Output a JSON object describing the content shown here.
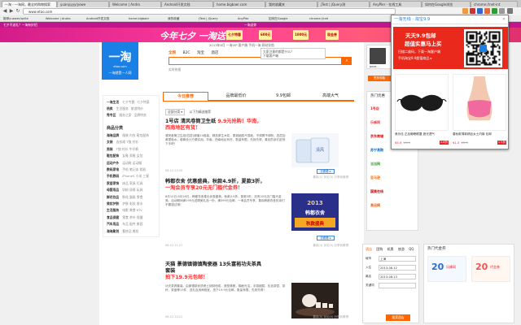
{
  "browser": {
    "tabs": [
      {
        "label": "一淘 - 一淘网，最全的购物搜索"
      },
      {
        "label": "yuanyyyy/yowe"
      },
      {
        "label": "Welcome | Andro"
      },
      {
        "label": "Android开发文档"
      },
      {
        "label": "home.bigbaer.com"
      },
      {
        "label": "我的收藏夹"
      },
      {
        "label": "jTest | jQuery测"
      },
      {
        "label": "AnyPler - 在线工具"
      },
      {
        "label": "如何在Google浏览"
      },
      {
        "label": "chrome://net-int"
      }
    ],
    "url": "www.etao.com",
    "back_glyph": "◀",
    "forward_glyph": "▶",
    "reload_glyph": "↻",
    "bookmarks": [
      "推荐yuewer/qnlte",
      "Welcome | Andro",
      "Android开发文档",
      "home.bigbaer",
      "我的收藏",
      "jTest | jQuery",
      "AnyPler",
      "如何在Google",
      "chrome://net",
      "其他书签"
    ]
  },
  "top_strip": {
    "left": "七夕不送礼？一淘有妙招",
    "center": "一淘送你",
    "right": "登录  注册  我的一淘"
  },
  "banner": {
    "headline": "今年七夕 一淘送你",
    "chips": [
      "七夕特惠",
      "600元",
      "1000元",
      "现金券"
    ]
  },
  "logo": {
    "name": "一淘",
    "domain": "etao.com",
    "slogan": "一淘就是一人网"
  },
  "search": {
    "tabs": [
      "全网",
      "B2C",
      "淘宝",
      "酒店"
    ],
    "active_tab": "全网",
    "placeholder": "",
    "button_glyph": "⌕",
    "hot": "实时热搜"
  },
  "top_links": "2013年8月  一淘VIP  客户端  手机一淘  网站导航",
  "suggest": [
    "大家注意的都是什么？",
    "下载客户端"
  ],
  "categories": {
    "rows": [
      {
        "main": "一淘生活",
        "sub": [
          "七夕专题",
          "七夕特惠"
        ]
      },
      {
        "main": "热卖",
        "sub": [
          "生活服务",
          "旅游特价"
        ]
      },
      {
        "main": "秀专区",
        "sub": [
          "服务之家",
          "品牌特卖"
        ]
      }
    ],
    "head": "商品分类",
    "list": [
      {
        "main": "海淘品牌",
        "sub": "服装 内衣 鞋包配饰"
      },
      {
        "main": "女装",
        "sub": "连衣裙 T恤 衬衫"
      },
      {
        "main": "男装",
        "sub": "T恤 衬衫 牛仔裤"
      },
      {
        "main": "鞋包配饰",
        "sub": "女鞋 男鞋 女包"
      },
      {
        "main": "运动户外",
        "sub": "运动鞋 运动服"
      },
      {
        "main": "数码家电",
        "sub": "手机 笔记本 相机"
      },
      {
        "main": "手机数码",
        "sub": "iPhone5 小米 三星"
      },
      {
        "main": "家居家饰",
        "sub": "床品 家具 灯具"
      },
      {
        "main": "母婴用品",
        "sub": "奶粉 尿裤 玩具"
      },
      {
        "main": "鲜花饮品",
        "sub": "鲜花 蛋糕 零食"
      },
      {
        "main": "美妆护肤",
        "sub": "护肤 彩妆 香水"
      },
      {
        "main": "生活服务",
        "sub": "电影 美食 KTV"
      },
      {
        "main": "食品保健",
        "sub": "零食 茶叶 保健"
      },
      {
        "main": "汽车用品",
        "sub": "车品 配件 美容"
      },
      {
        "main": "海淘聚划",
        "sub": "奢侈品 美妆"
      }
    ]
  },
  "content_tabs": [
    "今日推荐",
    "品牌最低价",
    "9.9包邮",
    "高端大气"
  ],
  "active_content_tab": "今日推荐",
  "filter": {
    "select": "全部分类 ▾",
    "note": "以下为精选推荐"
  },
  "articles": [
    {
      "title_a": "1号店 清风卷筒卫生纸",
      "title_b": "9.9元抢购！华南，",
      "title_c": "西南地区有货！",
      "body": "清风卷筒卫生纸(四层)超值10卷装，精选原生木浆，柔韧细腻不易破，不掉屑不掉粉，四层加厚更吸水，卷筒设计方便实用。华南、西南地区有货，数量有限，先到先得，喜欢的亲们赶快下手吧！",
      "meta": "08-12 13:35",
      "actions": "喜欢(1)  评论(0)  分享到微博",
      "buy": "去看看 ▸"
    },
    {
      "title_a": "韩都衣舍 优惠盛典，秋款4.9折，夏款3折，",
      "title_b": "一淘会员专享20元无门槛代金券！",
      "body": "8月10日-8月16日，韩都衣舍推出优惠盛典，秋款4.9折，夏款3折，还有20元无门槛代金券。活动期间满199元送精美礼品一份，满399元包邮，一淘会员专享，喜欢韩都衣舍的亲们不要错过哦！",
      "meta": "08-12 11:27",
      "actions": "喜欢(4)  评论(0)  分享到微博",
      "buy": "去看看 ▸",
      "thumb": [
        "韩都衣舍",
        "2013",
        "秋款盛典"
      ]
    },
    {
      "title_a": "天猫 景德镇德镇陶瓷器 13头富裕功夫茶具",
      "title_b": "套装",
      "title_c": "拍下19.9元包邮！",
      "body": "功夫茶具套装，由景德镇优质瓷土烧制而成，造型典雅，釉面光洁，手感细腻。包含茶壶、茶杯、茶盘等13件，送礼自用两相宜，拍下19.9元包邮，数量有限，先到先得！",
      "meta": "08-12 10:21",
      "actions": "喜欢(0)  评论(0)  分享到微博",
      "buy": "去看看 ▸"
    }
  ],
  "sidebar": {
    "user": "pazz...",
    "signin": "签到领取",
    "hot_title": "热门优惠",
    "brand_logos": [
      "1号店",
      "乐蜂网",
      "京东商城",
      "苏宁易购",
      "当当网",
      "亚马逊",
      "国美在线",
      "易迅网"
    ],
    "hotel_tabs": [
      "酒店",
      "团购",
      "机票",
      "旅游",
      "QQ"
    ],
    "hotel_fields": [
      {
        "label": "城市",
        "value": "上海"
      },
      {
        "label": "入住",
        "value": "2013-08-12"
      },
      {
        "label": "离店",
        "value": "2013-08-13"
      },
      {
        "label": "关键词",
        "value": ""
      }
    ],
    "hotel_button": "搜索酒店",
    "coupon_title": "热门代金券",
    "coupons": [
      {
        "amount": "20",
        "brand": "乐蜂网"
      },
      {
        "amount": "20",
        "brand": "代金券"
      }
    ]
  },
  "popup": {
    "title": "一淘无线 · 淘宝9.9",
    "close": "✕",
    "promo_line1": "天天9.9包邮",
    "promo_line2": "超值实惠马上买",
    "promo_line3": "扫描二维码，下载一淘客户端",
    "promo_line4": "手机淘宝9.9超值商品 ▸",
    "products": [
      {
        "name": "美乐佳 正品睡眠眼罩 遮光透气",
        "price": "¥5.9",
        "orig": "¥9.9",
        "discount": "3.8折"
      },
      {
        "name": "春秋款薄款精品女士内裤 包邮",
        "price": "¥1.5",
        "orig": "¥9.9",
        "discount": "1.5折"
      }
    ]
  },
  "colors": {
    "accent": "#ff6600",
    "brand_blue": "#1a80e6",
    "banner_pink": "#d31c8a",
    "promo_red": "#e8291c"
  }
}
